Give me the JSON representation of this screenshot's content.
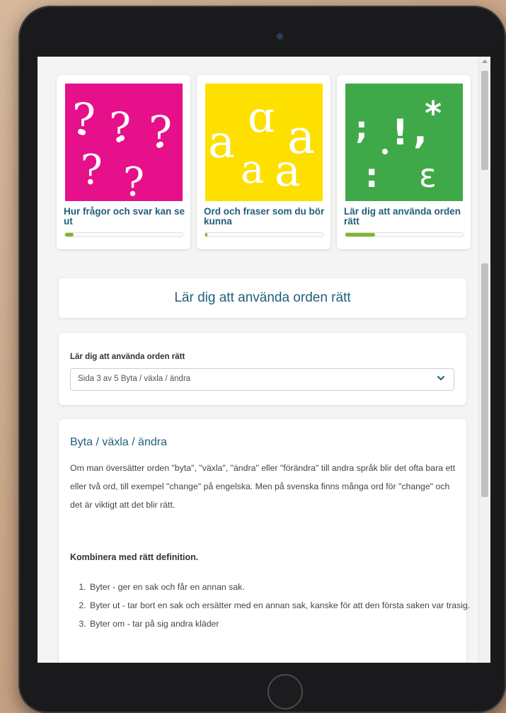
{
  "cards": [
    {
      "title": "Hur frågor och svar kan se ut",
      "color": "#e6108a",
      "progress": 0.07
    },
    {
      "title": "Ord och fraser som du bör kunna",
      "color": "#fde000",
      "progress": 0.02
    },
    {
      "title": "Lär dig att använda orden rätt",
      "color": "#3fa94a",
      "progress": 0.25
    }
  ],
  "main": {
    "title": "Lär dig att använda orden rätt",
    "select_label": "Lär dig att använda orden rätt",
    "select_value": "Sida 3 av 5 Byta / växla / ändra",
    "heading": "Byta / växla / ändra",
    "paragraph": "Om man översätter orden \"byta\", \"växla\", \"ändra\" eller \"förändra\" till andra språk blir det ofta bara ett eller två ord, till exempel \"change\" på engelska. Men på svenska finns många ord för \"change\" och det är viktigt att det blir rätt.",
    "subheading": "Kombinera med rätt definition.",
    "list": [
      "Byter - ger en sak och får en annan sak.",
      "Byter ut - tar bort en sak och ersätter med en annan sak, kanske för att den första saken var trasig.",
      "Byter om - tar på sig andra kläder"
    ]
  },
  "colors": {
    "accent": "#1f5f7a",
    "progress": "#7cb82f"
  },
  "icons": [
    "chevron-down-icon",
    "question-marks-illustration",
    "letters-a-illustration",
    "punctuation-illustration"
  ]
}
